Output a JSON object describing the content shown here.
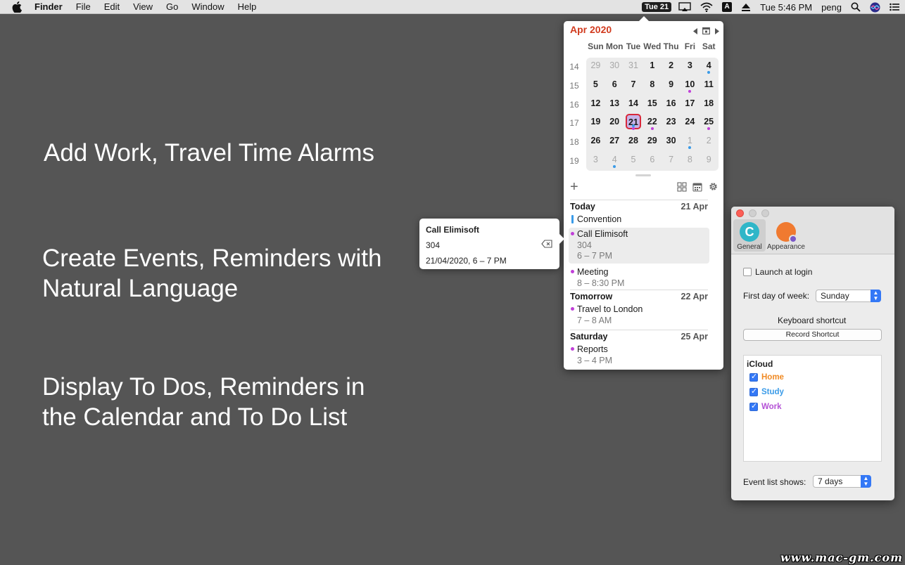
{
  "menubar": {
    "app_name": "Finder",
    "items": [
      "File",
      "Edit",
      "View",
      "Go",
      "Window",
      "Help"
    ],
    "date_badge": "Tue 21",
    "clock": "Tue 5:46 PM",
    "user": "peng",
    "input_source": "A"
  },
  "promo": {
    "line1": "Add Work, Travel Time Alarms",
    "line2a": "Create Events, Reminders with",
    "line2b": "Natural Language",
    "line3a": "Display To Dos, Reminders in",
    "line3b": "the Calendar and To Do List"
  },
  "calendar": {
    "title": "Apr 2020",
    "weekdays": [
      "Sun",
      "Mon",
      "Tue",
      "Wed",
      "Thu",
      "Fri",
      "Sat"
    ],
    "week_numbers": [
      "14",
      "15",
      "16",
      "17",
      "18",
      "19"
    ],
    "days": [
      "29",
      "30",
      "31",
      "1",
      "2",
      "3",
      "4",
      "5",
      "6",
      "7",
      "8",
      "9",
      "10",
      "11",
      "12",
      "13",
      "14",
      "15",
      "16",
      "17",
      "18",
      "19",
      "20",
      "21",
      "22",
      "23",
      "24",
      "25",
      "26",
      "27",
      "28",
      "29",
      "30",
      "1",
      "2",
      "3",
      "4",
      "5",
      "6",
      "7",
      "8",
      "9"
    ],
    "colors": {
      "accent": "#d13b1f",
      "purple": "#c040d8",
      "blue": "#3a9be8",
      "today_border": "#d8283a"
    }
  },
  "events": {
    "today_label": "Today",
    "today_date": "21 Apr",
    "convention": "Convention",
    "call_title": "Call Elimisoft",
    "call_loc": "304",
    "call_time": "6 – 7 PM",
    "meeting_title": "Meeting",
    "meeting_time": "8 – 8:30 PM",
    "tomorrow_label": "Tomorrow",
    "tomorrow_date": "22 Apr",
    "travel_title": "Travel to London",
    "travel_time": "7 – 8 AM",
    "saturday_label": "Saturday",
    "saturday_date": "25 Apr",
    "reports_title": "Reports",
    "reports_time": "3 – 4 PM"
  },
  "detail": {
    "title": "Call Elimisoft",
    "location": "304",
    "when": "21/04/2020, 6 – 7 PM"
  },
  "prefs": {
    "tab_general": "General",
    "tab_appearance": "Appearance",
    "launch_label": "Launch at login",
    "launch_checked": false,
    "first_day_label": "First day of week:",
    "first_day_value": "Sunday",
    "shortcut_heading": "Keyboard shortcut",
    "record_button": "Record Shortcut",
    "account": "iCloud",
    "calendars": [
      {
        "name": "Home",
        "color": "#f08a24",
        "checked": true
      },
      {
        "name": "Study",
        "color": "#3a9be8",
        "checked": true
      },
      {
        "name": "Work",
        "color": "#b452d6",
        "checked": true
      }
    ],
    "event_list_label": "Event list shows:",
    "event_list_value": "7 days"
  },
  "watermark": "www.mac-gm.com"
}
